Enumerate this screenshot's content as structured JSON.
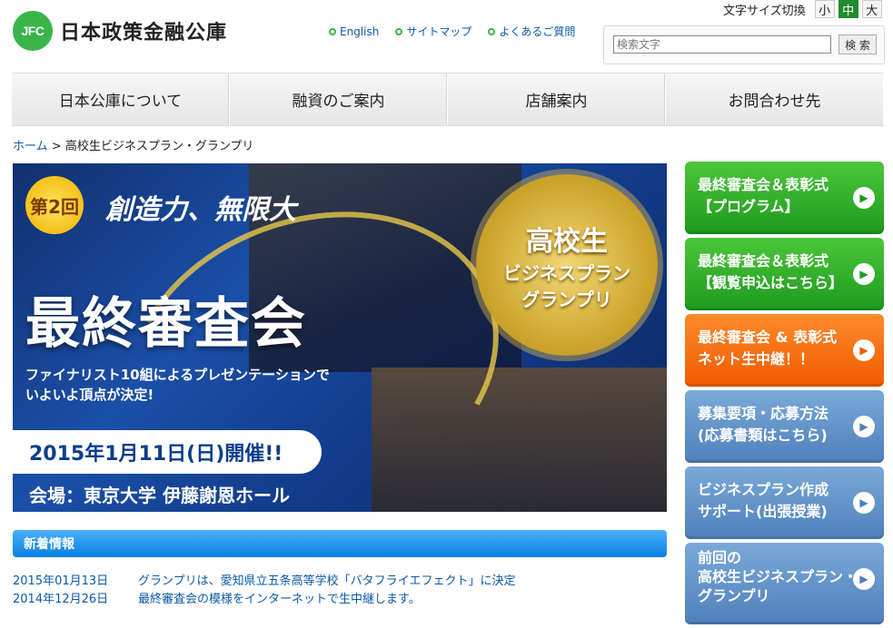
{
  "header": {
    "logo_mark": "JFC",
    "logo_text": "日本政策金融公庫",
    "links": [
      "English",
      "サイトマップ",
      "よくあるご質問"
    ],
    "fontsize_label": "文字サイズ切換",
    "fontsize_options": [
      "小",
      "中",
      "大"
    ],
    "search_placeholder": "検索文字",
    "search_button": "検 索"
  },
  "nav": [
    "日本公庫について",
    "融資のご案内",
    "店舗案内",
    "お問合わせ先"
  ],
  "breadcrumb": {
    "home": "ホーム",
    "separator": ">",
    "current": "高校生ビジネスプラン・グランプリ"
  },
  "banner": {
    "badge": "第2回",
    "tagline": "創造力、無限大",
    "medal": [
      "高校生",
      "ビジネスプラン",
      "グランプリ"
    ],
    "headline": "最終審査会",
    "sub1": "ファイナリスト10組によるプレゼンテーションで",
    "sub2": "いよいよ頂点が決定!",
    "date": "2015年1月11日(日)開催!!",
    "venue": "会場：東京大学 伊藤謝恩ホール"
  },
  "news": {
    "title": "新着情報",
    "items": [
      {
        "date": "2015年01月13日",
        "text": "グランプリは、愛知県立五条高等学校「バタフライエフェクト」に決定"
      },
      {
        "date": "2014年12月26日",
        "text": "最終審査会の模様をインターネットで生中継します。"
      }
    ]
  },
  "side_buttons": [
    {
      "line1": "最終審査会＆表彰式",
      "line2": "【プログラム】",
      "color": "green"
    },
    {
      "line1": "最終審査会＆表彰式",
      "line2": "【観覧申込はこちら】",
      "color": "green"
    },
    {
      "line1": "最終審査会 & 表彰式",
      "line2": "ネット生中継！！",
      "color": "orange"
    },
    {
      "line1": "募集要項・応募方法",
      "line2": "(応募書類はこちら)",
      "color": "blue"
    },
    {
      "line1": "ビジネスプラン作成",
      "line2": "サポート(出張授業)",
      "color": "blue"
    },
    {
      "line1": "前回の",
      "line2": "高校生ビジネスプラン・",
      "line3": "グランプリ",
      "color": "blue"
    }
  ]
}
